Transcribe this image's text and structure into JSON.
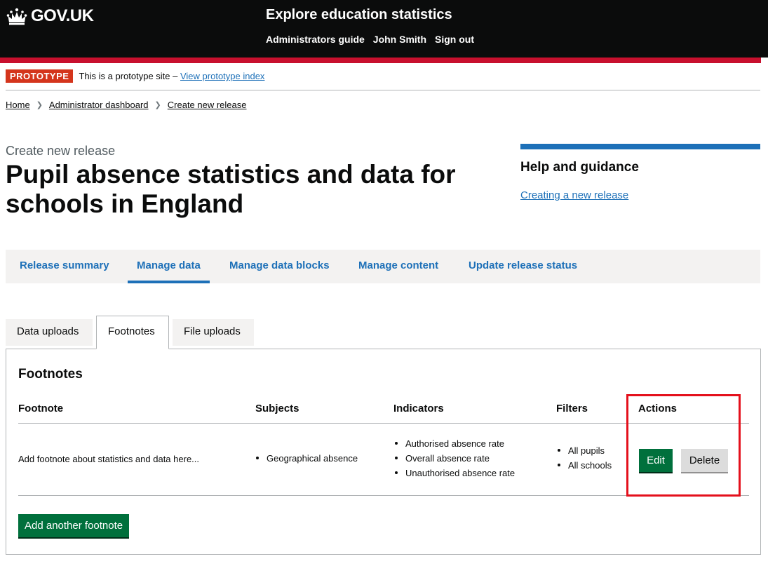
{
  "header": {
    "logo_text": "GOV.UK",
    "service_name": "Explore education statistics",
    "nav": [
      "Administrators guide",
      "John Smith",
      "Sign out"
    ]
  },
  "phase": {
    "tag": "PROTOTYPE",
    "text": "This is a prototype site –",
    "link": "View prototype index"
  },
  "breadcrumb": [
    "Home",
    "Administrator dashboard",
    "Create new release"
  ],
  "caption": "Create new release",
  "title": "Pupil absence statistics and data for schools in England",
  "help": {
    "title": "Help and guidance",
    "link": "Creating a new release"
  },
  "nav_tabs": [
    {
      "label": "Release summary",
      "active": false
    },
    {
      "label": "Manage data",
      "active": true
    },
    {
      "label": "Manage data blocks",
      "active": false
    },
    {
      "label": "Manage content",
      "active": false
    },
    {
      "label": "Update release status",
      "active": false
    }
  ],
  "sub_tabs": [
    {
      "label": "Data uploads",
      "active": false
    },
    {
      "label": "Footnotes",
      "active": true
    },
    {
      "label": "File uploads",
      "active": false
    }
  ],
  "panel": {
    "title": "Footnotes",
    "columns": [
      "Footnote",
      "Subjects",
      "Indicators",
      "Filters",
      "Actions"
    ],
    "rows": [
      {
        "footnote": "Add footnote about statistics and data here...",
        "subjects": [
          "Geographical absence"
        ],
        "indicators": [
          "Authorised absence rate",
          "Overall absence rate",
          "Unauthorised absence rate"
        ],
        "filters": [
          "All pupils",
          "All schools"
        ],
        "actions": {
          "edit": "Edit",
          "delete": "Delete"
        }
      }
    ],
    "add_button": "Add another footnote"
  },
  "colors": {
    "header_bg": "#0b0c0c",
    "header_bar": "#c8102e",
    "link_blue": "#1d70b8",
    "button_green": "#00703c",
    "highlight_red": "#e4101c"
  }
}
